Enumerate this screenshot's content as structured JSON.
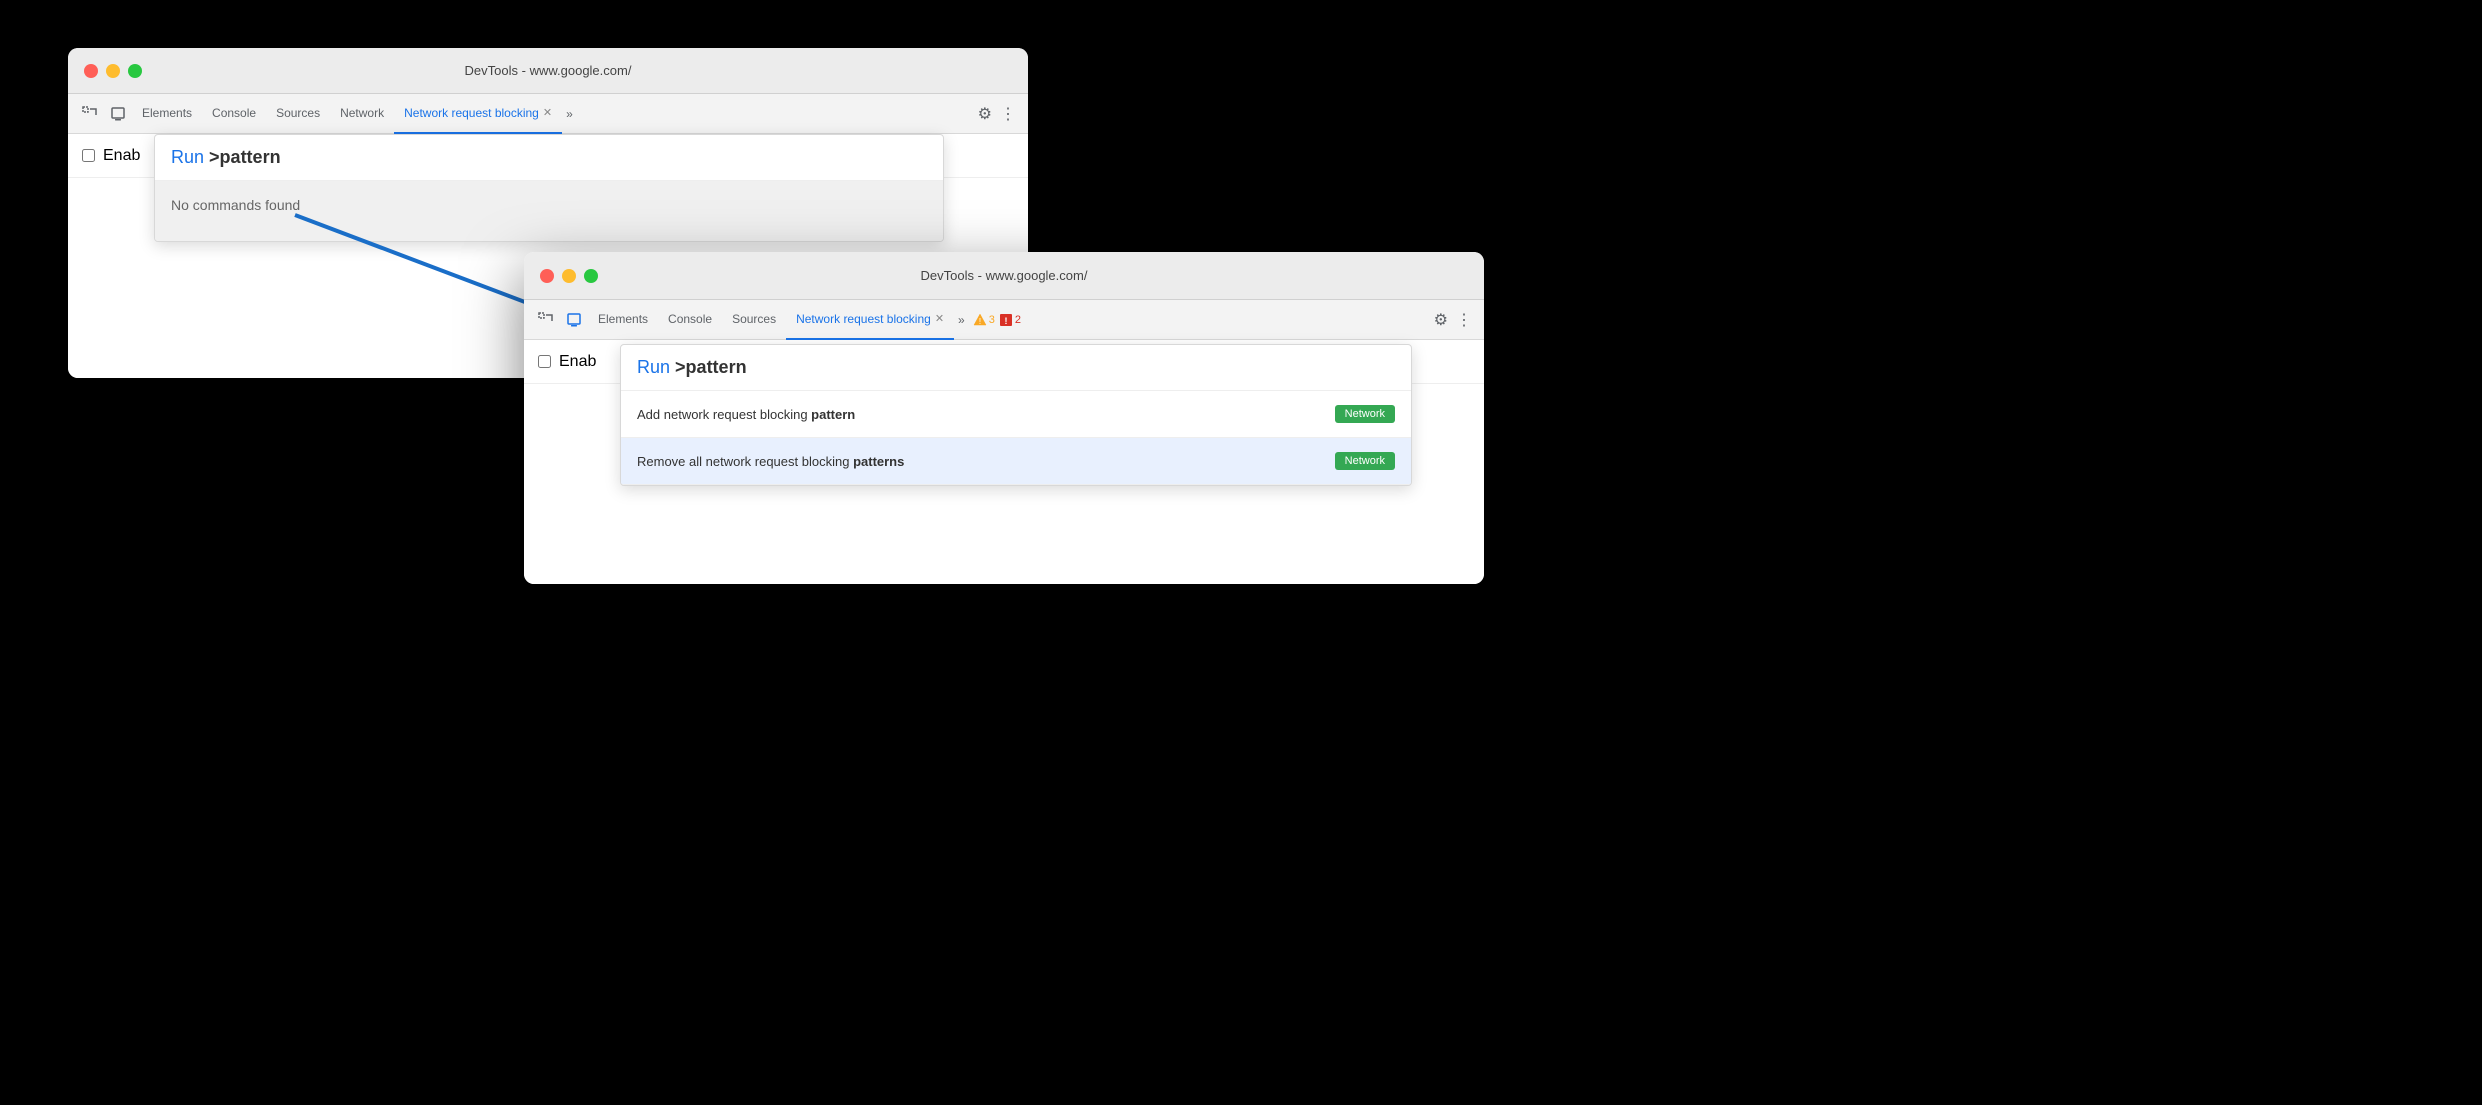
{
  "window1": {
    "title": "DevTools - www.google.com/",
    "tabs": [
      {
        "label": "Elements",
        "active": false
      },
      {
        "label": "Console",
        "active": false
      },
      {
        "label": "Sources",
        "active": false
      },
      {
        "label": "Network",
        "active": false
      },
      {
        "label": "Network request blocking",
        "active": true
      }
    ],
    "toolbar": {
      "more_label": "»",
      "gear_label": "⚙",
      "more_dots": "⋮"
    },
    "content": {
      "enable_label": "Enab"
    },
    "command_palette": {
      "run_label": "Run",
      "pattern_label": ">pattern",
      "no_results": "No commands found"
    }
  },
  "window2": {
    "title": "DevTools - www.google.com/",
    "tabs": [
      {
        "label": "Elements",
        "active": false
      },
      {
        "label": "Console",
        "active": false
      },
      {
        "label": "Sources",
        "active": false
      },
      {
        "label": "Network request blocking",
        "active": true
      }
    ],
    "toolbar": {
      "more_label": "»",
      "gear_label": "⚙",
      "more_dots": "⋮",
      "warning_count": "3",
      "error_count": "2"
    },
    "content": {
      "enable_label": "Enab"
    },
    "command_palette": {
      "run_label": "Run",
      "pattern_label": ">pattern",
      "result1_prefix": "Add network request blocking ",
      "result1_bold": "pattern",
      "result1_badge": "Network",
      "result2_prefix": "Remove all network request blocking ",
      "result2_bold": "patterns",
      "result2_suffix": "s",
      "result2_badge": "Network"
    }
  }
}
